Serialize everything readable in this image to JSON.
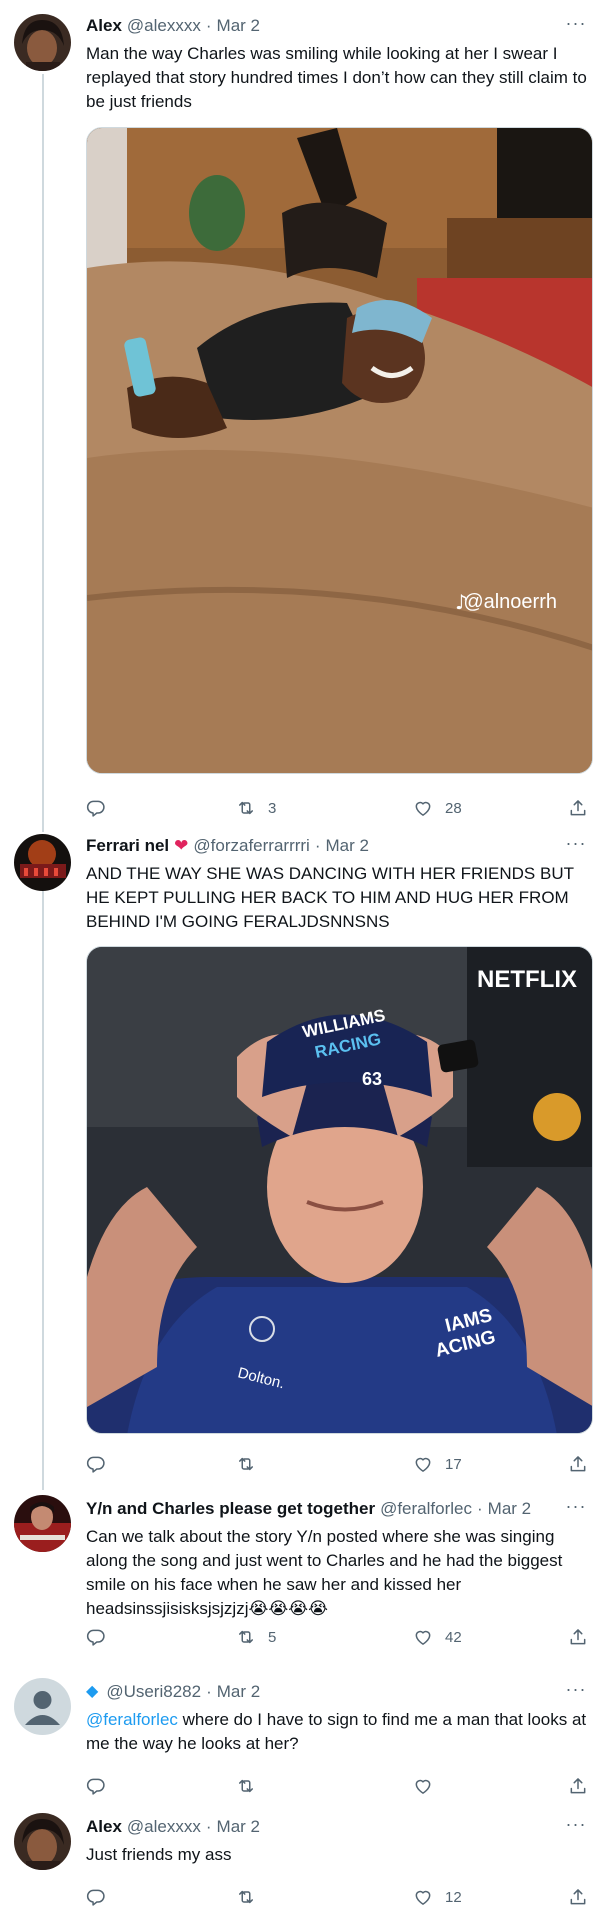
{
  "tweets": [
    {
      "name": "Alex",
      "handle": "@alexxxx",
      "date": "Mar 2",
      "text": "Man the way Charles was smiling while looking at her I swear I replayed that story hundred times I don’t how can they still claim to be just friends",
      "media_watermark": "@alnoerrh",
      "retweets": "3",
      "likes": "28"
    },
    {
      "name": "Ferrari nel",
      "handle": "@forzaferrarrrri",
      "date": "Mar 2",
      "text": "AND THE WAY SHE WAS DANCING WITH HER FRIENDS BUT HE KEPT PULLING HER BACK TO HIM AND HUG HER FROM BEHIND I'M GOING FERALJDSNNSNS",
      "media_brand": "NETFLIX",
      "cap_line1": "WILLIAMS",
      "cap_line2": "RACING",
      "cap_number": "63",
      "shirt_line1": "IAMS",
      "shirt_line2": "ACING",
      "shirt_sponsor": "Dolton.",
      "retweets": "",
      "likes": "17"
    },
    {
      "name": "Y/n and Charles please get together",
      "handle": "@feralforlec",
      "date": "Mar 2",
      "text": "Can we talk about the story Y/n posted where she was singing along the song and just went to Charles and he had the biggest smile on his face when he saw her and kissed her headsinssjisisksjsjzjzj😭😭😭😭",
      "retweets": "5",
      "likes": "42"
    },
    {
      "name": "",
      "handle": "@Useri8282",
      "date": "Mar 2",
      "reply_mention": "@feralforlec",
      "text": " where do I have to sign to find me a man that looks at me the way he looks at her?",
      "retweets": "",
      "likes": ""
    },
    {
      "name": "Alex",
      "handle": "@alexxxx",
      "date": "Mar 2",
      "text": "Just friends my ass",
      "retweets": "",
      "likes": "12"
    }
  ],
  "ui": {
    "sep": "·",
    "more": "···"
  },
  "icons": [
    "reply-icon",
    "retweet-icon",
    "like-icon",
    "share-icon",
    "more-icon",
    "heart-emoji",
    "diamond-emoji"
  ],
  "colors": {
    "accent": "#1d9bf0",
    "text": "#0f1419",
    "secondary": "#536471",
    "thread_line": "#cfd9de",
    "heart": "#e0245e"
  }
}
